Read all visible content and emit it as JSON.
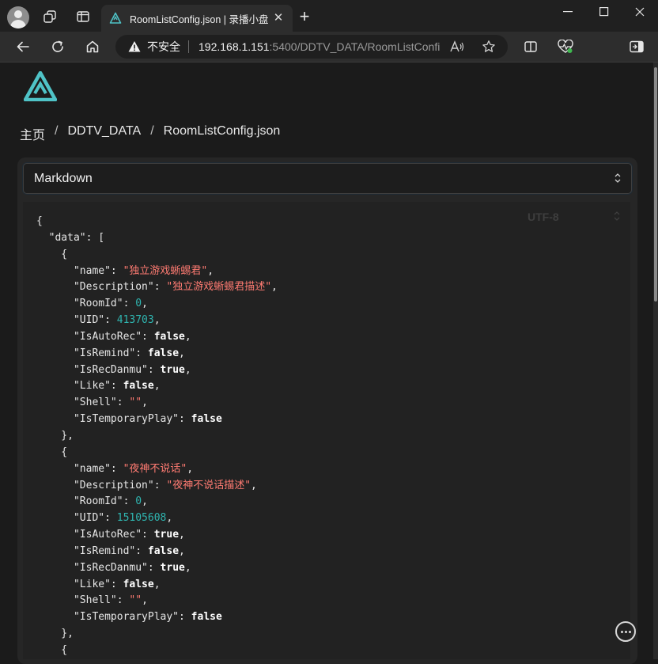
{
  "browser": {
    "tab_title": "RoomListConfig.json | 录播小盘",
    "tab_close": "✕",
    "new_tab": "+",
    "security_label": "不安全",
    "url_host": "192.168.1.151",
    "url_rest": ":5400/DDTV_DATA/RoomListConfi...",
    "colors": {
      "titlebar": "#202020",
      "toolbar": "#2d2d2d",
      "omnibox": "#1f1f1f"
    }
  },
  "breadcrumb": {
    "items": [
      "主页",
      "DDTV_DATA",
      "RoomListConfig.json"
    ],
    "separator": "/"
  },
  "viewer": {
    "format_select": "Markdown",
    "encoding": "UTF-8"
  },
  "json_content": {
    "open_brace": "{",
    "data_key": "\"data\"",
    "rooms": [
      {
        "name": "\"独立游戏蜥蜴君\"",
        "description": "\"独立游戏蜥蜴君描述\"",
        "room_id": "0",
        "uid": "413703",
        "is_auto_rec": "false",
        "is_remind": "false",
        "is_rec_danmu": "true",
        "like": "false",
        "shell": "\"\"",
        "is_temporary_play": "false"
      },
      {
        "name": "\"夜神不说话\"",
        "description": "\"夜神不说话描述\"",
        "room_id": "0",
        "uid": "15105608",
        "is_auto_rec": "true",
        "is_remind": "false",
        "is_rec_danmu": "true",
        "like": "false",
        "shell": "\"\"",
        "is_temporary_play": "false"
      }
    ]
  },
  "theme": {
    "string_color": "#ff7b72",
    "number_color": "#2fb5b0",
    "accent": "#4fc3c7"
  }
}
